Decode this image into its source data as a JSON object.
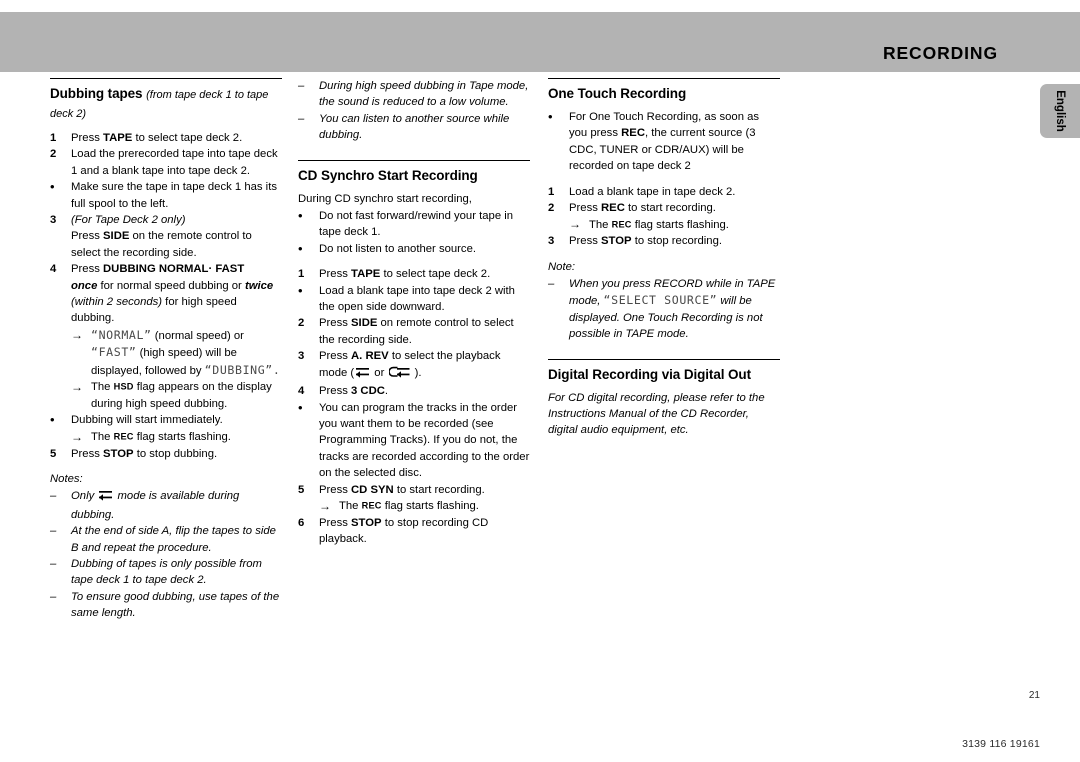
{
  "header": {
    "title": "RECORDING",
    "language_tab": "English"
  },
  "footer": {
    "page_number": "21",
    "part_number": "3139 116 19161"
  },
  "column1": {
    "section_title": "Dubbing tapes",
    "section_subtitle": "(from tape deck 1 to tape deck 2)",
    "steps": [
      {
        "marker": "1",
        "text_pre": "Press ",
        "bold": "TAPE",
        "text_post": " to select tape deck 2."
      },
      {
        "marker": "2",
        "text": "Load the prerecorded tape into tape deck 1 and a blank tape into tape deck 2."
      },
      {
        "marker": "•",
        "text": "Make sure the tape in tape deck 1 has its full spool to the left."
      },
      {
        "marker": "3",
        "italic_line": "(For Tape Deck 2 only)",
        "text_pre": "Press ",
        "bold": "SIDE",
        "text_post": " on the remote control to select the recording side."
      },
      {
        "marker": "4",
        "text_pre": "Press ",
        "bold": "DUBBING NORMAL· FAST"
      }
    ],
    "step4_detail_once": "once",
    "step4_detail_once_rest": " for normal speed dubbing or ",
    "step4_detail_twice": "twice",
    "step4_detail_twice_paren": "(within 2 seconds)",
    "step4_detail_tail": " for high speed dubbing.",
    "arrow1_lcd_normal": "“NORMAL”",
    "arrow1_mid": " (normal speed) or ",
    "arrow1_lcd_fast": "“FAST”",
    "arrow1_mid2": " (high speed) will be displayed, followed by ",
    "arrow1_lcd_dubbing": "“DUBBING”.",
    "arrow2_pre": "The ",
    "arrow2_flag": "HSD",
    "arrow2_post": " flag appears on the display during high speed dubbing.",
    "bullet_start": "Dubbing will start immediately.",
    "arrow3_pre": "The ",
    "arrow3_flag": "REC",
    "arrow3_post": " flag starts flashing.",
    "step5_pre": "Press ",
    "step5_bold": "STOP",
    "step5_post": " to stop dubbing.",
    "notes_label": "Notes:",
    "notes": [
      {
        "marker": "–",
        "pre": "Only ",
        "glyph": "tape-autoreverse-icon",
        "post": " mode is available during dubbing."
      },
      {
        "marker": "–",
        "text": "At the end of side A, flip the tapes to side B and repeat the procedure."
      },
      {
        "marker": "–",
        "text": "Dubbing of tapes is only possible from tape deck 1 to tape deck 2."
      },
      {
        "marker": "–",
        "text": "To ensure good dubbing, use tapes of the same length."
      }
    ]
  },
  "column2": {
    "top_notes": [
      {
        "marker": "–",
        "text": "During high speed dubbing in Tape mode, the sound is reduced to a low volume."
      },
      {
        "marker": "–",
        "text": "You can listen to another source while dubbing."
      }
    ],
    "section_title": "CD Synchro Start Recording",
    "intro": "During CD synchro start recording,",
    "cautions": [
      {
        "marker": "•",
        "text": "Do not fast forward/rewind your tape in tape deck 1."
      },
      {
        "marker": "•",
        "text": "Do not listen to another source."
      }
    ],
    "steps": [
      {
        "marker": "1",
        "text_pre": "Press ",
        "bold": "TAPE",
        "text_post": " to select tape deck 2."
      },
      {
        "marker": "•",
        "text": "Load a blank tape into tape deck 2 with the open side downward."
      },
      {
        "marker": "2",
        "text_pre": "Press ",
        "bold": "SIDE",
        "text_post": " on remote control to select the recording side."
      },
      {
        "marker": "3",
        "text_pre": "Press ",
        "bold": "A. REV",
        "text_post": " to select the playback mode (",
        "glyph_a": "tape-autoreverse-icon",
        "mid": " or ",
        "glyph_b": "tape-autoreverse-repeat-icon",
        "tail": " )."
      },
      {
        "marker": "4",
        "text_pre": "Press ",
        "bold": "3 CDC",
        "text_post": "."
      },
      {
        "marker": "•",
        "text": "You can program the tracks in the order you want them to be recorded (see Programming Tracks). If you do not, the tracks are recorded according to the order on the selected disc."
      },
      {
        "marker": "5",
        "text_pre": "Press ",
        "bold": "CD SYN",
        "text_post": " to start recording."
      },
      {
        "marker": "6",
        "text_pre": "Press ",
        "bold": "STOP",
        "text_post": " to stop recording CD playback."
      }
    ],
    "arrow_rec_pre": "The ",
    "arrow_rec_flag": "REC",
    "arrow_rec_post": " flag starts flashing."
  },
  "column3": {
    "section_title": "One Touch Recording",
    "intro_bullet_marker": "•",
    "intro_pre": "For One Touch Recording, as soon as you press ",
    "intro_bold": "REC",
    "intro_post": ", the current source (3 CDC, TUNER or CDR/AUX) will be recorded on tape deck 2",
    "steps": [
      {
        "marker": "1",
        "text": "Load a blank tape in tape deck 2."
      },
      {
        "marker": "2",
        "text_pre": "Press ",
        "bold": "REC",
        "text_post": " to start recording."
      },
      {
        "marker": "3",
        "text_pre": "Press ",
        "bold": "STOP",
        "text_post": " to stop recording."
      }
    ],
    "arrow_rec_pre": "The ",
    "arrow_rec_flag": "REC",
    "arrow_rec_post": " flag starts flashing.",
    "note_label": "Note:",
    "note_marker": "–",
    "note_pre": "When you press RECORD while in TAPE mode, ",
    "note_lcd": "“SELECT SOURCE”",
    "note_post": " will be displayed.  One Touch Recording is not possible in TAPE mode.",
    "section2_title": "Digital Recording via Digital Out",
    "section2_body": "For CD digital recording, please refer to the Instructions Manual of the CD Recorder, digital audio equipment, etc."
  }
}
